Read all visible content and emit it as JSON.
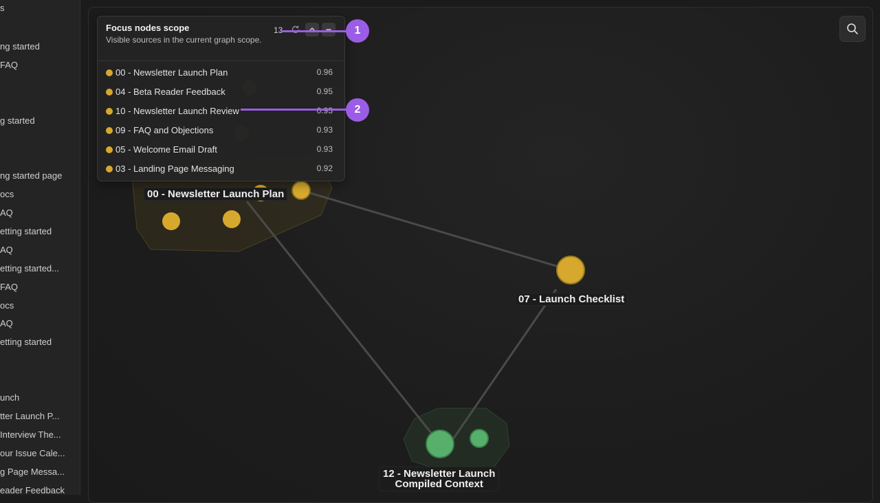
{
  "sidebar": {
    "items": [
      "s",
      "ng started",
      "FAQ",
      "g started",
      "ng started page",
      "ocs",
      "AQ",
      "etting started",
      "AQ",
      "etting started...",
      "FAQ",
      "ocs",
      "AQ",
      "etting started",
      "unch",
      "tter Launch P...",
      " Interview The...",
      "our Issue Cale...",
      "g Page Messa...",
      "eader Feedback"
    ]
  },
  "graph": {
    "labels": {
      "plan": "00 - Newsletter Launch Plan",
      "checklist": "07 - Launch Checklist",
      "compiled_line1": "12 - Newsletter Launch",
      "compiled_line2": "Compiled Context"
    },
    "colors": {
      "gold": "#d6a92e",
      "green": "#56b06b",
      "edge": "#4a4a4a"
    }
  },
  "panel": {
    "title": "Focus nodes scope",
    "subtitle": "Visible sources in the current graph scope.",
    "count": "13",
    "rows": [
      {
        "name": "00 - Newsletter Launch Plan",
        "score": "0.96"
      },
      {
        "name": "04 - Beta Reader Feedback",
        "score": "0.95"
      },
      {
        "name": "10 - Newsletter Launch Review",
        "score": "0.93"
      },
      {
        "name": "09 - FAQ and Objections",
        "score": "0.93"
      },
      {
        "name": "05 - Welcome Email Draft",
        "score": "0.93"
      },
      {
        "name": "03 - Landing Page Messaging",
        "score": "0.92"
      }
    ]
  },
  "callouts": {
    "one": "1",
    "two": "2"
  },
  "accent": "#9b5de5"
}
